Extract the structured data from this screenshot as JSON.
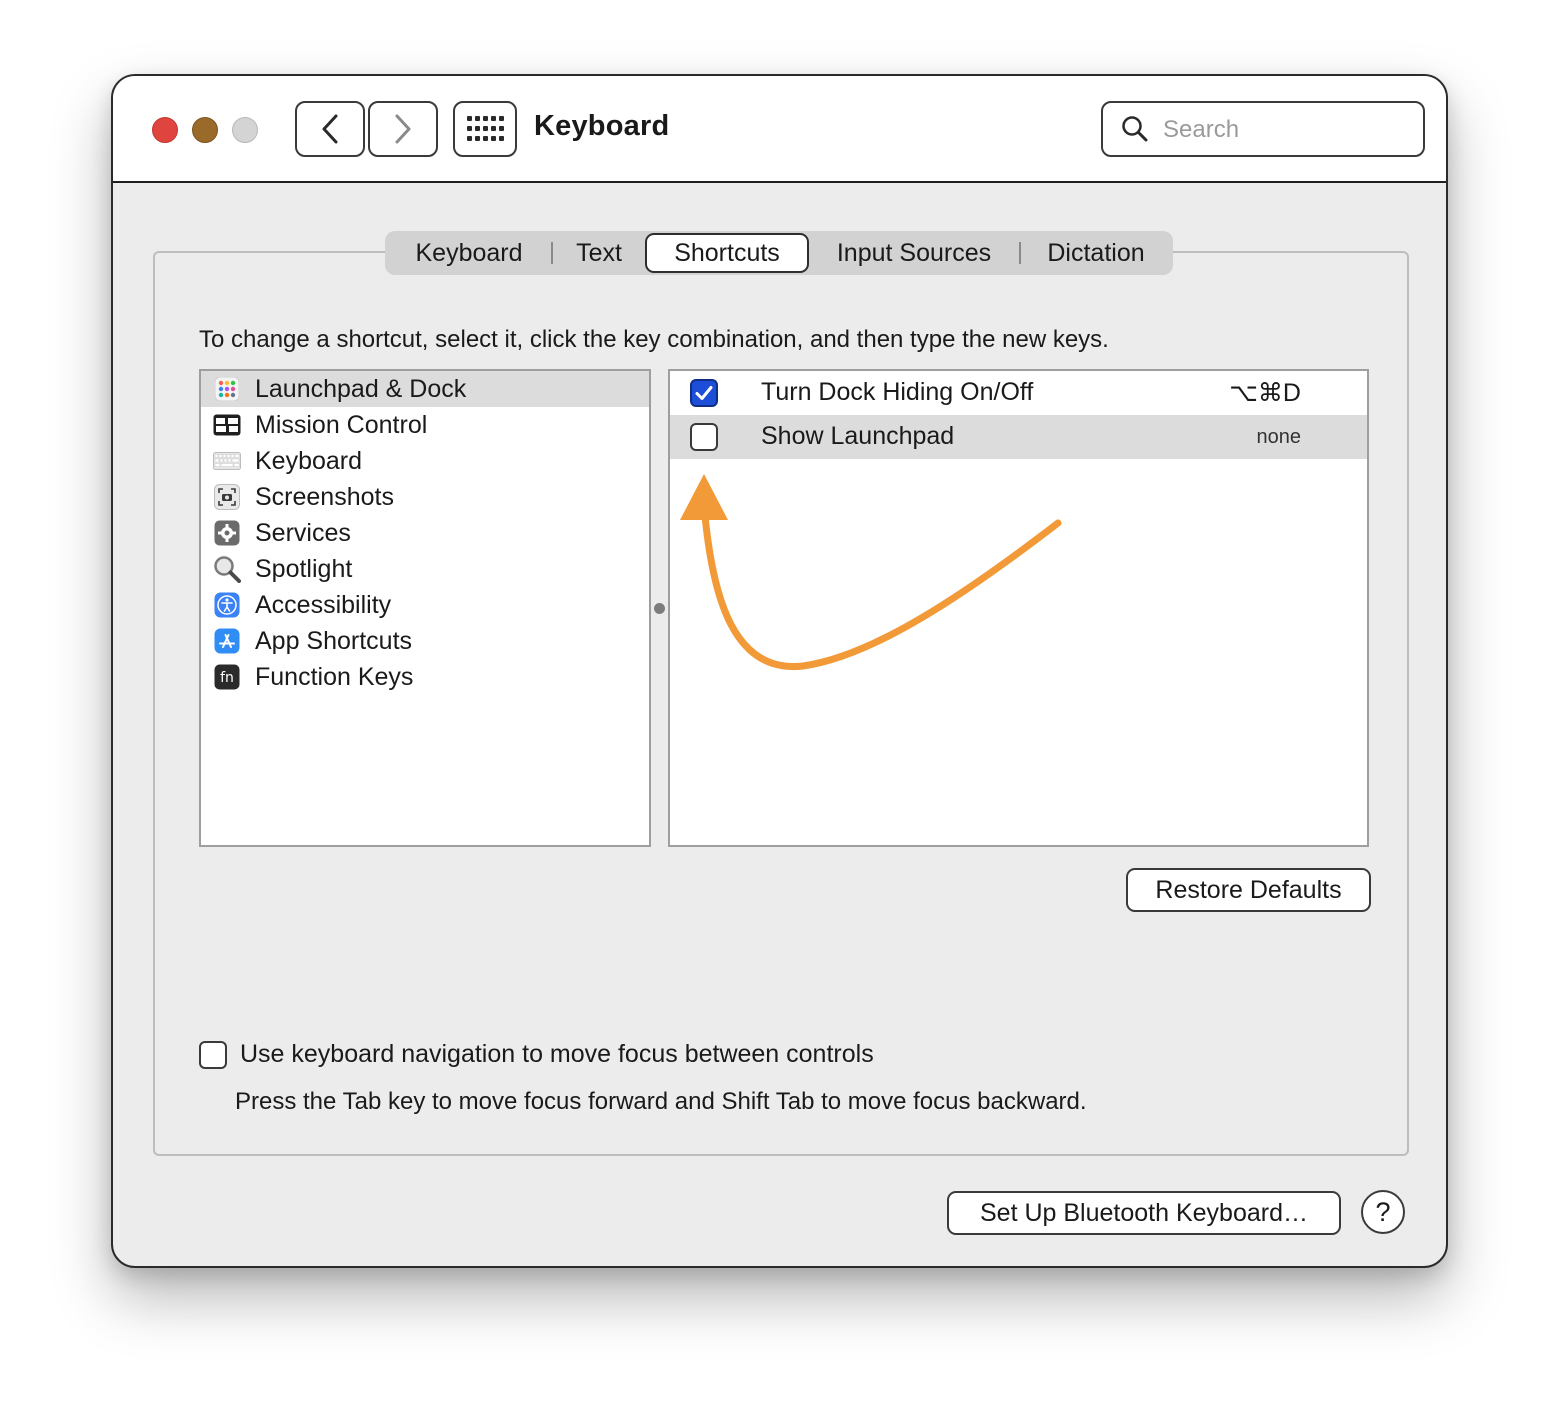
{
  "window": {
    "title": "Keyboard"
  },
  "search": {
    "placeholder": "Search"
  },
  "tabs": [
    {
      "label": "Keyboard",
      "active": false
    },
    {
      "label": "Text",
      "active": false
    },
    {
      "label": "Shortcuts",
      "active": true
    },
    {
      "label": "Input Sources",
      "active": false
    },
    {
      "label": "Dictation",
      "active": false
    }
  ],
  "instructions": "To change a shortcut, select it, click the key combination, and then type the new keys.",
  "categories": [
    {
      "label": "Launchpad & Dock",
      "icon": "launchpad-icon",
      "selected": true
    },
    {
      "label": "Mission Control",
      "icon": "mission-control-icon",
      "selected": false
    },
    {
      "label": "Keyboard",
      "icon": "keyboard-icon",
      "selected": false
    },
    {
      "label": "Screenshots",
      "icon": "screenshot-icon",
      "selected": false
    },
    {
      "label": "Services",
      "icon": "gear-icon",
      "selected": false
    },
    {
      "label": "Spotlight",
      "icon": "magnifier-icon",
      "selected": false
    },
    {
      "label": "Accessibility",
      "icon": "accessibility-icon",
      "selected": false
    },
    {
      "label": "App Shortcuts",
      "icon": "app-store-icon",
      "selected": false
    },
    {
      "label": "Function Keys",
      "icon": "fn-key-icon",
      "selected": false
    }
  ],
  "shortcuts": [
    {
      "label": "Turn Dock Hiding On/Off",
      "keys": "⌥⌘D",
      "checked": true,
      "selected": false
    },
    {
      "label": "Show Launchpad",
      "keys": "none",
      "checked": false,
      "selected": true
    }
  ],
  "buttons": {
    "restore_defaults": "Restore Defaults",
    "bluetooth": "Set Up Bluetooth Keyboard…",
    "help": "?"
  },
  "keyboard_navigation": {
    "label": "Use keyboard navigation to move focus between controls",
    "checked": false,
    "description": "Press the Tab key to move focus forward and Shift Tab to move focus backward."
  },
  "colors": {
    "accent": "#1d4ed8",
    "annotation_arrow": "#f29a38",
    "close": "#e0443e",
    "minimize": "#9a6a2a",
    "zoom": "#d4d4d4"
  }
}
